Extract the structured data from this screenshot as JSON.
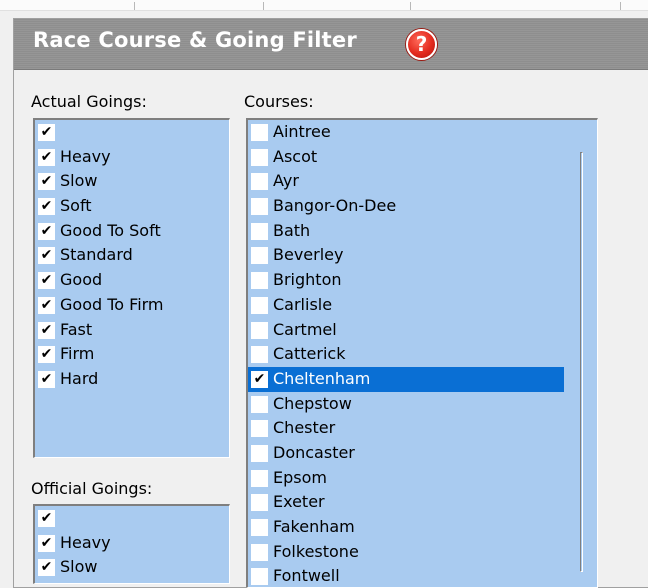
{
  "panel": {
    "title": "Race Course & Going Filter",
    "help_icon": "help-icon",
    "help_glyph": "?"
  },
  "actual_goings": {
    "label": "Actual Goings:",
    "items": [
      {
        "label": "",
        "checked": true
      },
      {
        "label": "Heavy",
        "checked": true
      },
      {
        "label": "Slow",
        "checked": true
      },
      {
        "label": "Soft",
        "checked": true
      },
      {
        "label": "Good To Soft",
        "checked": true
      },
      {
        "label": "Standard",
        "checked": true
      },
      {
        "label": "Good",
        "checked": true
      },
      {
        "label": "Good To Firm",
        "checked": true
      },
      {
        "label": "Fast",
        "checked": true
      },
      {
        "label": "Firm",
        "checked": true
      },
      {
        "label": "Hard",
        "checked": true
      }
    ]
  },
  "official_goings": {
    "label": "Official Goings:",
    "items": [
      {
        "label": "",
        "checked": true
      },
      {
        "label": "Heavy",
        "checked": true
      },
      {
        "label": "Slow",
        "checked": true
      }
    ]
  },
  "courses": {
    "label": "Courses:",
    "items": [
      {
        "label": "Aintree",
        "checked": false
      },
      {
        "label": "Ascot",
        "checked": false
      },
      {
        "label": "Ayr",
        "checked": false
      },
      {
        "label": "Bangor-On-Dee",
        "checked": false
      },
      {
        "label": "Bath",
        "checked": false
      },
      {
        "label": "Beverley",
        "checked": false
      },
      {
        "label": "Brighton",
        "checked": false
      },
      {
        "label": "Carlisle",
        "checked": false
      },
      {
        "label": "Cartmel",
        "checked": false
      },
      {
        "label": "Catterick",
        "checked": false
      },
      {
        "label": "Cheltenham",
        "checked": true,
        "selected": true
      },
      {
        "label": "Chepstow",
        "checked": false
      },
      {
        "label": "Chester",
        "checked": false
      },
      {
        "label": "Doncaster",
        "checked": false
      },
      {
        "label": "Epsom",
        "checked": false
      },
      {
        "label": "Exeter",
        "checked": false
      },
      {
        "label": "Fakenham",
        "checked": false
      },
      {
        "label": "Folkestone",
        "checked": false
      },
      {
        "label": "Fontwell",
        "checked": false
      }
    ]
  },
  "colors": {
    "list_background": "#a9cbf0",
    "selection": "#0a6fd4",
    "titlebar": "#8e8e8e",
    "help_red": "#e32b1f"
  }
}
